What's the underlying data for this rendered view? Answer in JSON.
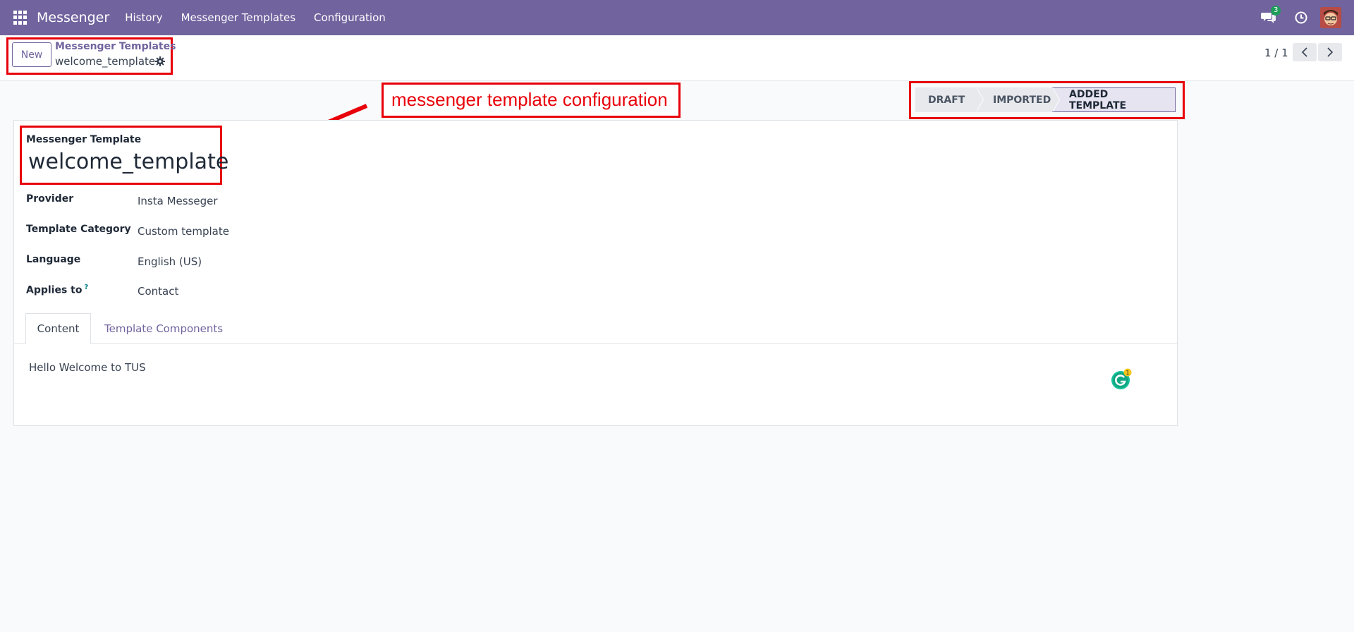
{
  "navbar": {
    "brand": "Messenger",
    "items": [
      {
        "label": "History"
      },
      {
        "label": "Messenger Templates"
      },
      {
        "label": "Configuration"
      }
    ],
    "chat_count": "3"
  },
  "control_panel": {
    "new_label": "New",
    "breadcrumb_parent": "Messenger Templates",
    "breadcrumb_current": "welcome_template",
    "pager_value": "1 / 1"
  },
  "annotation": {
    "text": "messenger template configuration"
  },
  "status_bar": {
    "stages": [
      {
        "label": "DRAFT"
      },
      {
        "label": "IMPORTED"
      },
      {
        "label": "ADDED TEMPLATE"
      }
    ],
    "active_stage": "ADDED TEMPLATE"
  },
  "form": {
    "title_label": "Messenger Template",
    "title_value": "welcome_template",
    "fields": [
      {
        "label": "Provider",
        "value": "Insta Messeger"
      },
      {
        "label": "Template Category",
        "value": "Custom template"
      },
      {
        "label": "Language",
        "value": "English (US)"
      },
      {
        "label": "Applies to",
        "value": "Contact",
        "help": "?"
      }
    ],
    "tabs": [
      {
        "label": "Content"
      },
      {
        "label": "Template Components"
      }
    ],
    "content_text": "Hello Welcome to TUS",
    "grammarly_badge": "1"
  },
  "colors": {
    "brand": "#71639e",
    "annotation": "#e8000a",
    "badge": "#1e9d5a"
  }
}
